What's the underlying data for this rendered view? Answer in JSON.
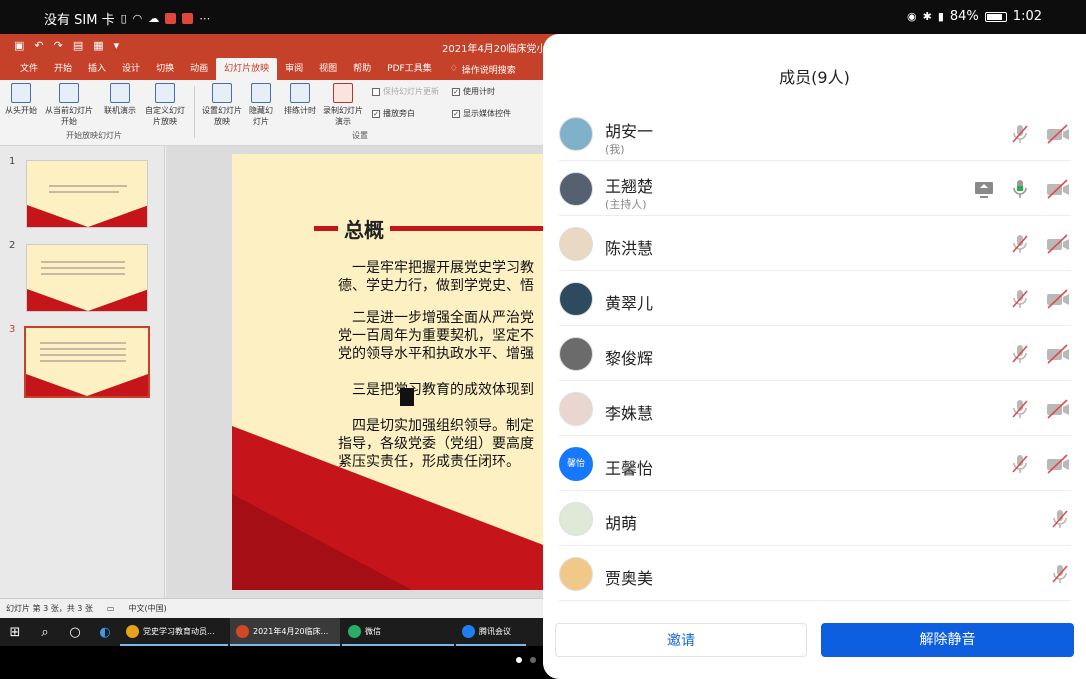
{
  "status_bar": {
    "carrier": "没有 SIM 卡",
    "battery": "84%",
    "time": "1:02",
    "battery_level": 0.84
  },
  "ppt": {
    "doc_title": "2021年4月20临床党小组学",
    "tabs": [
      "文件",
      "开始",
      "插入",
      "设计",
      "切换",
      "动画",
      "幻灯片放映",
      "审阅",
      "视图",
      "帮助",
      "PDF工具集"
    ],
    "active_tab": "幻灯片放映",
    "search": "操作说明搜索",
    "ribbon": {
      "from_start": "从头开始",
      "from_current": "从当前幻灯片开始",
      "online": "联机演示",
      "custom": "自定义幻灯片放映",
      "group1": "开始放映幻灯片",
      "setup": "设置幻灯片放映",
      "hide": "隐藏幻灯片",
      "rehearse": "排练计时",
      "record": "录制幻灯片演示",
      "keep_updated": "保持幻灯片更新",
      "play_narration": "播放旁白",
      "use_timings": "使用计时",
      "show_media": "显示媒体控件",
      "group2": "设置"
    },
    "thumb_numbers": [
      "1",
      "2",
      "3"
    ],
    "slide": {
      "title": "总概",
      "p1a": "一是牢牢把握开展党史学习教",
      "p1b": "德、学史力行，做到学党史、悟",
      "p2a": "二是进一步增强全面从严治党",
      "p2b": "党一百周年为重要契机，坚定不",
      "p2c": "党的领导水平和执政水平、增强",
      "p3": "三是把党习教育的成效体现到",
      "p4a": "四是切实加强组织领导。制定",
      "p4b": "指导，各级党委（党组）要高度",
      "p4c": "紧压实责任，形成责任闭环。"
    },
    "statusline": {
      "slide_info": "幻灯片 第 3 张，共 3 张",
      "lang": "中文(中国)"
    }
  },
  "taskbar": {
    "apps": [
      {
        "label": "党史学习教育动员...",
        "color": "#e6a21b"
      },
      {
        "label": "2021年4月20临床...",
        "color": "#d24726"
      },
      {
        "label": "微信",
        "color": "#2aae67"
      },
      {
        "label": "腾讯会议",
        "color": "#1e7ef2"
      }
    ]
  },
  "members_panel": {
    "title": "成员(9人)",
    "members": [
      {
        "name": "胡安一",
        "sub": "(我)"
      },
      {
        "name": "王翘楚",
        "sub": "(主持人)"
      },
      {
        "name": "陈洪慧",
        "sub": ""
      },
      {
        "name": "黄翠儿",
        "sub": ""
      },
      {
        "name": "黎俊辉",
        "sub": ""
      },
      {
        "name": "李姝慧",
        "sub": ""
      },
      {
        "name": "王馨怡",
        "sub": "",
        "avatar_text": "馨怡"
      },
      {
        "name": "胡萌",
        "sub": ""
      },
      {
        "name": "贾奥美",
        "sub": ""
      }
    ],
    "invite": "邀请",
    "unmute": "解除静音"
  }
}
